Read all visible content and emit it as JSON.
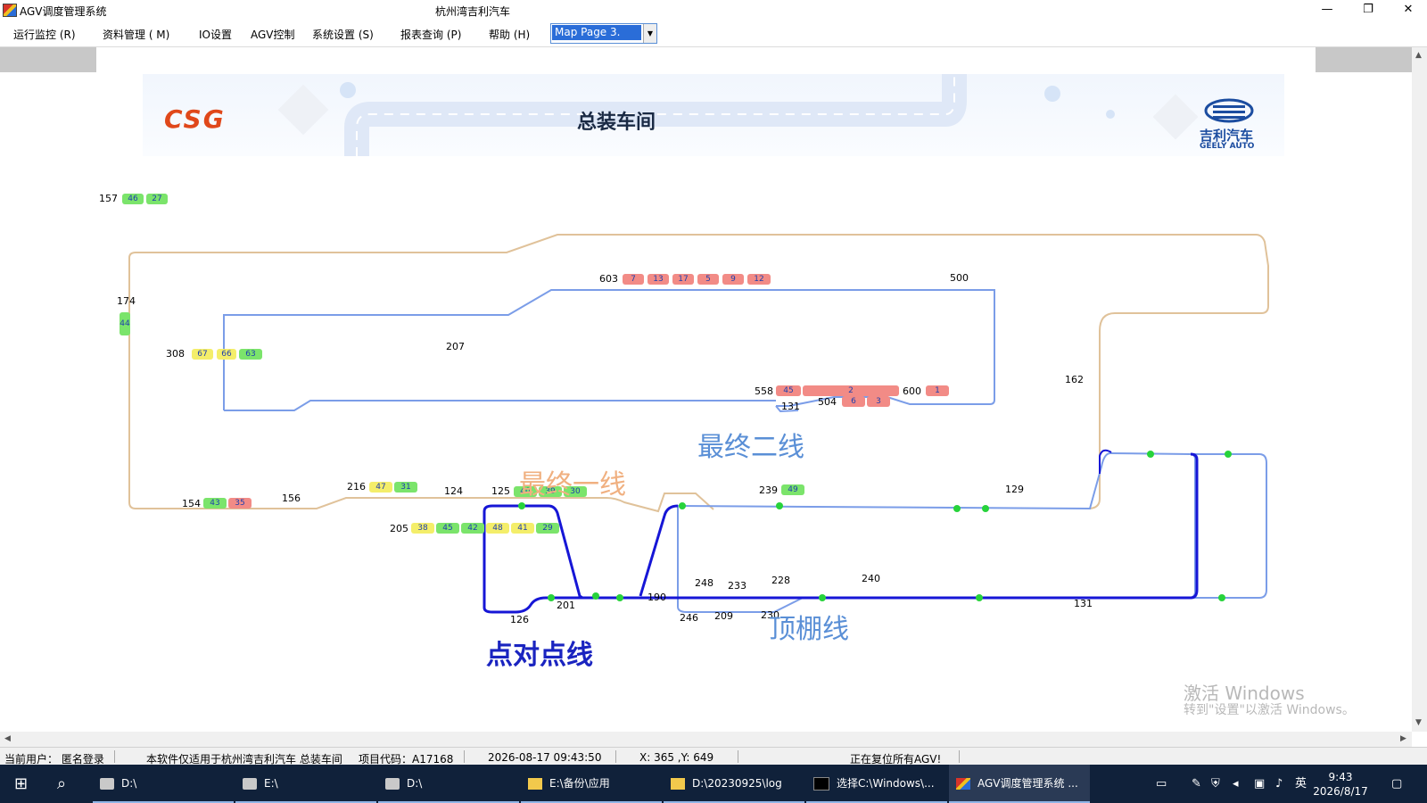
{
  "window": {
    "title": "AGV调度管理系统",
    "center_title": "杭州湾吉利汽车",
    "minimize": "—",
    "restore": "❐",
    "close": "✕"
  },
  "menu": {
    "items": [
      "运行监控 (R)",
      "资料管理 ( M)",
      "IO设置",
      "AGV控制",
      "系统设置 (S)",
      "报表查询 (P)",
      "帮助 (H)"
    ],
    "map_select": "Map Page 3."
  },
  "banner": {
    "logo_text": "CSG",
    "title": "总装车间",
    "brand_cn": "吉利汽车",
    "brand_en": "GEELY AUTO"
  },
  "nodes": {
    "n157": "157",
    "n174": "174",
    "n308": "308",
    "n207": "207",
    "n603": "603",
    "n500": "500",
    "n558": "558",
    "n131a": "131",
    "n504": "504",
    "n600": "600",
    "n162": "162",
    "n216": "216",
    "n124": "124",
    "n125": "125",
    "n154": "154",
    "n156": "156",
    "n239": "239",
    "n129": "129",
    "n205": "205",
    "n248": "248",
    "n233": "233",
    "n228": "228",
    "n240": "240",
    "n201": "201",
    "n190": "190",
    "n126": "126",
    "n246": "246",
    "n209": "209",
    "n230": "230",
    "n131b": "131"
  },
  "chips": {
    "c157a": "46",
    "c157b": "27",
    "c174": "44",
    "c308a": "67",
    "c308b": "66",
    "c308c": "63",
    "c603a": "7",
    "c603b": "13",
    "c603c": "17",
    "c603d": "5",
    "c603e": "9",
    "c603f": "12",
    "c558a": "45",
    "c558b": "2",
    "c600": "1",
    "c504a": "6",
    "c504b": "3",
    "c216a": "47",
    "c216b": "31",
    "c125a": "40",
    "c125b": "39",
    "c125c": "30",
    "c154a": "43",
    "c154b": "35",
    "c239": "49",
    "c205a": "38",
    "c205b": "45",
    "c205c": "42",
    "c205d": "48",
    "c205e": "41",
    "c205f": "29"
  },
  "zones": {
    "line2": "最终二线",
    "line1": "最终一线",
    "roof": "顶棚线",
    "p2p": "点对点线"
  },
  "colors": {
    "tan": "#e0c29a",
    "light_blue": "#7b9de8",
    "dark_blue": "#1616d6",
    "green_dot": "#27d33b",
    "label_line2": "#5a8fd6",
    "label_line1": "#f0b080",
    "label_roof": "#5a8fd6",
    "label_p2p": "#1a24c0"
  },
  "watermark": {
    "line1": "激活 Windows",
    "line2": "转到\"设置\"以激活 Windows。"
  },
  "status": {
    "user": "当前用户： 匿名登录",
    "notice": "本软件仅适用于杭州湾吉利汽车 总装车间",
    "project": "项目代码：A17168",
    "datetime": "2026-08-17  09:43:50",
    "coords": "X:  365 ,Y:  649",
    "message": "正在复位所有AGV!"
  },
  "taskbar": {
    "tasks": [
      "D:\\",
      "E:\\",
      "D:\\",
      "E:\\备份\\应用",
      "D:\\20230925\\log",
      "选择C:\\Windows\\...",
      "AGV调度管理系统 ..."
    ],
    "ime": "英",
    "time": "9:43",
    "date": "2026/8/17"
  }
}
